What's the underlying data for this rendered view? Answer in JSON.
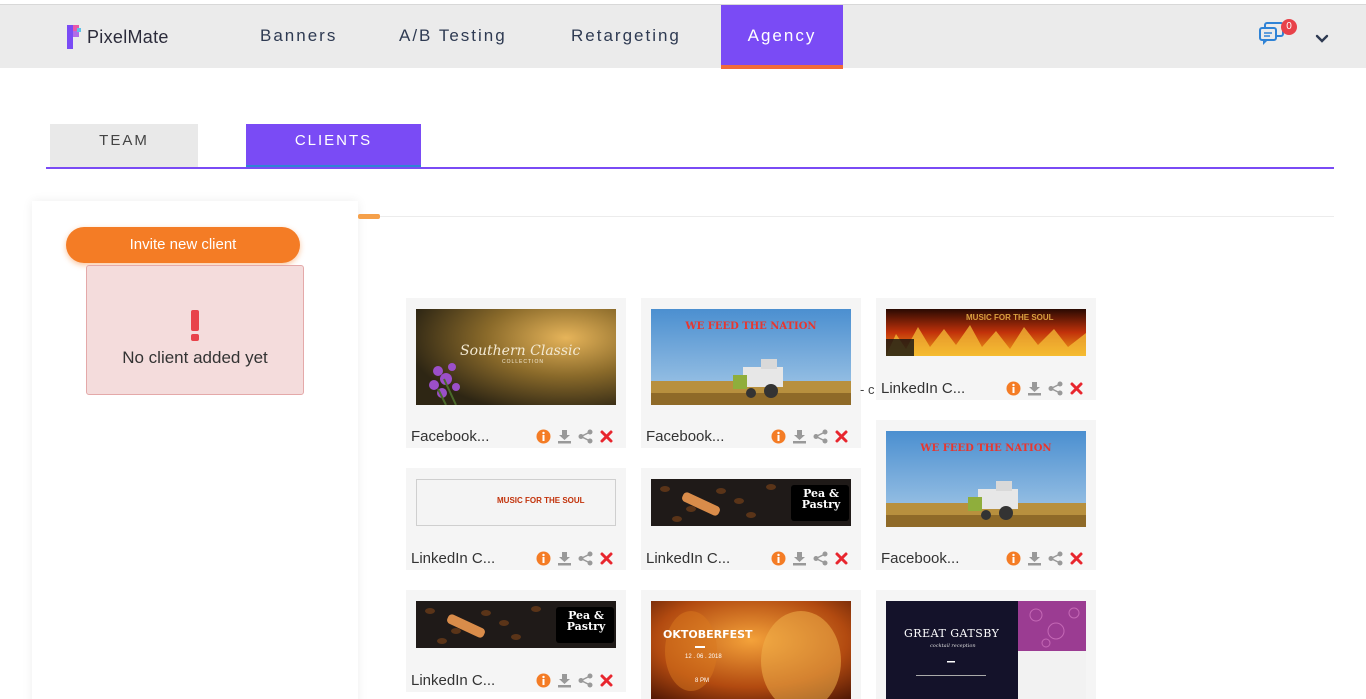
{
  "app": {
    "name": "PixelMate"
  },
  "nav": {
    "items": [
      {
        "label": "Banners"
      },
      {
        "label": "A/B Testing"
      },
      {
        "label": "Retargeting"
      },
      {
        "label": "Agency"
      }
    ],
    "notification_count": "0"
  },
  "tabs": [
    {
      "label": "TEAM"
    },
    {
      "label": "CLIENTS"
    }
  ],
  "clients_panel": {
    "invite_label": "Invite new client",
    "empty_message": "No client added yet"
  },
  "banners": [
    {
      "label": "Facebook...",
      "thumb_text": "Southern Classic",
      "thumb_sub": "COLLECTION"
    },
    {
      "label": "Facebook...",
      "thumb_text": "WE FEED THE NATION"
    },
    {
      "label": "LinkedIn C...",
      "thumb_text": "MUSIC FOR THE SOUL"
    },
    {
      "label": "LinkedIn C...",
      "thumb_text": "MUSIC FOR THE SOUL"
    },
    {
      "label": "LinkedIn C...",
      "thumb_text": "Pea & Pastry"
    },
    {
      "label": "Facebook...",
      "thumb_text": "WE FEED THE NATION"
    },
    {
      "label": "LinkedIn C...",
      "thumb_text": "Pea & Pastry"
    },
    {
      "label": "",
      "thumb_text": "OKTOBERFEST",
      "thumb_sub": "12 . 06 . 2018",
      "thumb_sub2": "8 PM"
    },
    {
      "label": "",
      "thumb_text": "GREAT GATSBY",
      "thumb_sub": "cocktail reception"
    }
  ],
  "stray_text": "- c",
  "colors": {
    "accent": "#7a4bf5",
    "orange": "#f47c25",
    "danger": "#e8424a",
    "info": "#f47c25"
  }
}
